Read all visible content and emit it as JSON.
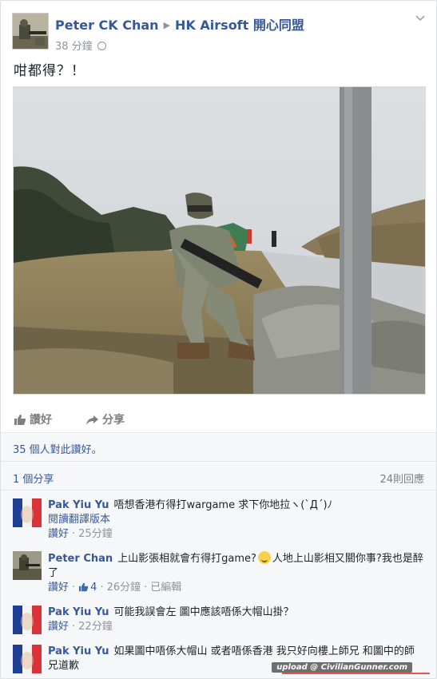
{
  "post": {
    "author": "Peter CK Chan",
    "group": "HK Airsoft 開心同盟",
    "time": "38 分鐘",
    "text": "咁都得？！"
  },
  "actions": {
    "like_label": "讚好",
    "share_label": "分享"
  },
  "stats": {
    "likes_text": "35 個人對此讚好。",
    "shares_text": "1 個分享",
    "replies_text": "24則回應"
  },
  "comments": [
    {
      "name": "Pak Yiu Yu",
      "text": "唔想香港冇得打wargame 求下你地拉ヽ(`Д´)ﾉ",
      "extra": "閱讀翻譯版本",
      "like_label": "讚好",
      "time": "25分鐘"
    },
    {
      "name": "Peter Chan",
      "text_a": "上山影張相就會冇得打game?",
      "text_b": "人地上山影相又關你事?我也是醉了",
      "like_label": "讚好",
      "like_count": "4",
      "time": "26分鐘",
      "edited": "已編輯"
    },
    {
      "name": "Pak Yiu Yu",
      "text": "可能我誤會左 圖中應該唔係大帽山掛？",
      "like_label": "讚好",
      "time": "22分鐘"
    },
    {
      "name": "Pak Yiu Yu",
      "text": "如果圖中唔係大帽山 或者唔係香港 我只好向樓上師兄 和圖中的師兄道歉"
    }
  ],
  "watermark": "upload @ CivilianGunner.com",
  "colors": {
    "link": "#365899",
    "muted": "#90949c",
    "bar_bg": "#f6f7f9"
  }
}
